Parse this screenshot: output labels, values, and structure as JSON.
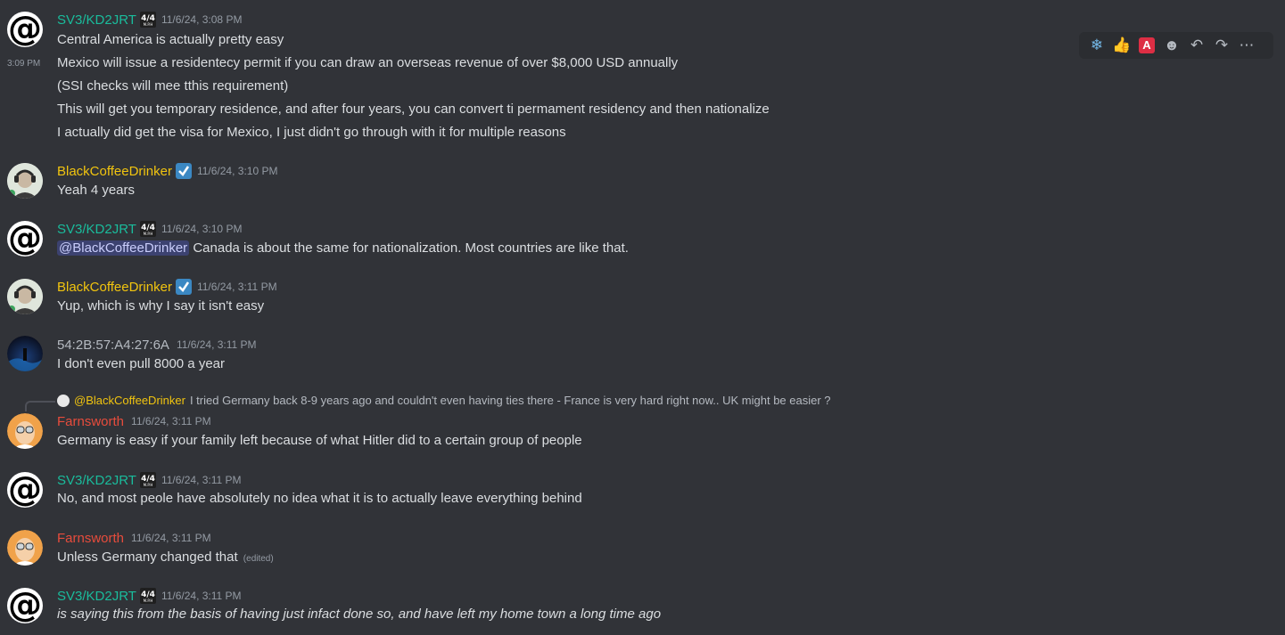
{
  "toolbar": {
    "icons": [
      "snowflake-reaction",
      "thumbs-up-reaction",
      "letter-a-reaction",
      "add-reaction-icon",
      "reply-icon",
      "forward-icon",
      "more-icon"
    ],
    "glyphs": [
      "❄",
      "👍",
      "A",
      "☻",
      "↶",
      "↷",
      "⋯"
    ]
  },
  "messages": [
    {
      "author": "SV3/KD2JRT",
      "badge": "4/4 M.P.H",
      "timestamp": "11/6/24, 3:08 PM",
      "lines": [
        "Central America is actually pretty easy"
      ]
    },
    {
      "side_timestamp": "3:09 PM",
      "lines": [
        "Mexico will issue a residentecy permit if you can draw an overseas revenue of over $8,000 USD annually",
        "(SSI checks will mee tthis requirement)",
        "This will get you temporary residence, and after four years, you can convert ti permament residency and then nationalize",
        "I actually did get the visa for Mexico, I just didn't go through with it for multiple reasons"
      ]
    },
    {
      "author": "BlackCoffeeDrinker",
      "timestamp": "11/6/24, 3:10 PM",
      "lines": [
        "Yeah 4 years"
      ]
    },
    {
      "author": "SV3/KD2JRT",
      "timestamp": "11/6/24, 3:10 PM",
      "mention": "@BlackCoffeeDrinker",
      "lines": [
        " Canada is about the same for nationalization. Most countries are like that."
      ]
    },
    {
      "author": "BlackCoffeeDrinker",
      "timestamp": "11/6/24, 3:11 PM",
      "lines": [
        "Yup, which is why I say it isn't easy"
      ]
    },
    {
      "author": "54:2B:57:A4:27:6A",
      "timestamp": "11/6/24, 3:11 PM",
      "lines": [
        "I don't even pull 8000 a year"
      ]
    },
    {
      "reply_to": "@BlackCoffeeDrinker",
      "reply_text": "I tried Germany back 8-9 years ago and couldn't even having ties there - France is very hard right now.. UK might be easier ?",
      "author": "Farnsworth",
      "timestamp": "11/6/24, 3:11 PM",
      "lines": [
        "Germany is easy if your family left because of what Hitler did to a certain group of people"
      ]
    },
    {
      "author": "SV3/KD2JRT",
      "timestamp": "11/6/24, 3:11 PM",
      "lines": [
        "No, and most peole have absolutely no idea what it is to actually leave everything behind"
      ]
    },
    {
      "author": "Farnsworth",
      "timestamp": "11/6/24, 3:11 PM",
      "lines": [
        "Unless Germany changed that"
      ],
      "edited": "(edited)"
    },
    {
      "author": "SV3/KD2JRT",
      "timestamp": "11/6/24, 3:11 PM",
      "lines": [
        "is saying this from the basis of having just infact done so, and have left my home town a long time ago"
      ]
    }
  ],
  "colors": {
    "background": "#313338",
    "sv3": "#1abc9c",
    "blackcoffee": "#f1c40f",
    "farnsworth": "#e74c3c",
    "mac": "#b5bac1",
    "mention_bg": "#3c4270"
  }
}
